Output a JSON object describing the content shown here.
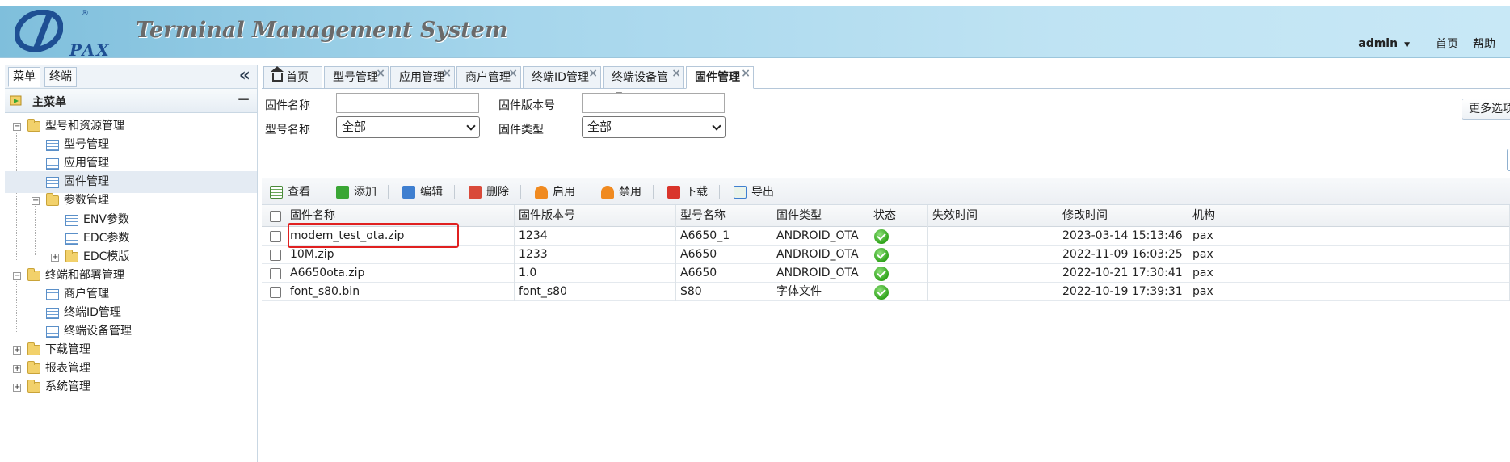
{
  "header": {
    "logo_text": "PAX",
    "logo_reg": "®",
    "title": "Terminal Management System",
    "user": "admin",
    "links": [
      "首页",
      "帮助"
    ]
  },
  "sidebar": {
    "tabs": [
      "菜单",
      "终端"
    ],
    "main_menu_title": "主菜单",
    "tree": [
      {
        "label": "型号和资源管理",
        "type": "folder",
        "level": 0,
        "expander": "−"
      },
      {
        "label": "型号管理",
        "type": "page",
        "level": 1
      },
      {
        "label": "应用管理",
        "type": "page",
        "level": 1
      },
      {
        "label": "固件管理",
        "type": "page",
        "level": 1,
        "selected": true
      },
      {
        "label": "参数管理",
        "type": "folder",
        "level": 1,
        "expander": "−"
      },
      {
        "label": "ENV参数",
        "type": "page",
        "level": 2
      },
      {
        "label": "EDC参数",
        "type": "page",
        "level": 2
      },
      {
        "label": "EDC模版",
        "type": "folder",
        "level": 2,
        "expander": "+"
      },
      {
        "label": "终端和部署管理",
        "type": "folder",
        "level": 0,
        "expander": "−"
      },
      {
        "label": "商户管理",
        "type": "page",
        "level": 1
      },
      {
        "label": "终端ID管理",
        "type": "page",
        "level": 1
      },
      {
        "label": "终端设备管理",
        "type": "page",
        "level": 1
      },
      {
        "label": "下载管理",
        "type": "folder",
        "level": 0,
        "expander": "+"
      },
      {
        "label": "报表管理",
        "type": "folder",
        "level": 0,
        "expander": "+"
      },
      {
        "label": "系统管理",
        "type": "folder",
        "level": 0,
        "expander": "+"
      }
    ]
  },
  "tabs": [
    {
      "label": "首页",
      "closable": false
    },
    {
      "label": "型号管理",
      "closable": true
    },
    {
      "label": "应用管理",
      "closable": true
    },
    {
      "label": "商户管理",
      "closable": true
    },
    {
      "label": "终端ID管理",
      "closable": true
    },
    {
      "label": "终端设备管理",
      "closable": true
    },
    {
      "label": "固件管理",
      "closable": true,
      "active": true
    }
  ],
  "search": {
    "firmware_name_label": "固件名称",
    "firmware_name_value": "",
    "firmware_version_label": "固件版本号",
    "firmware_version_value": "",
    "model_name_label": "型号名称",
    "model_name_value": "全部",
    "firmware_type_label": "固件类型",
    "firmware_type_value": "全部",
    "more_options": "更多选项"
  },
  "toolbar": {
    "view": "查看",
    "add": "添加",
    "edit": "编辑",
    "delete": "删除",
    "enable": "启用",
    "disable": "禁用",
    "download": "下载",
    "export": "导出"
  },
  "grid": {
    "columns": [
      "固件名称",
      "固件版本号",
      "型号名称",
      "固件类型",
      "状态",
      "失效时间",
      "修改时间",
      "机构"
    ],
    "rows": [
      {
        "name": "modem_test_ota.zip",
        "version": "1234",
        "model": "A6650_1",
        "type": "ANDROID_OTA",
        "status": "enabled",
        "expire": "",
        "modified": "2023-03-14 15:13:46",
        "org": "pax"
      },
      {
        "name": "10M.zip",
        "version": "1233",
        "model": "A6650",
        "type": "ANDROID_OTA",
        "status": "enabled",
        "expire": "",
        "modified": "2022-11-09 16:03:25",
        "org": "pax"
      },
      {
        "name": "A6650ota.zip",
        "version": "1.0",
        "model": "A6650",
        "type": "ANDROID_OTA",
        "status": "enabled",
        "expire": "",
        "modified": "2022-10-21 17:30:41",
        "org": "pax"
      },
      {
        "name": "font_s80.bin",
        "version": "font_s80",
        "model": "S80",
        "type": "字体文件",
        "status": "enabled",
        "expire": "",
        "modified": "2022-10-19 17:39:31",
        "org": "pax"
      }
    ]
  },
  "colors": {
    "header_gradient_start": "#7fbfdc",
    "header_gradient_end": "#c8e8f6",
    "status_ok": "#2fa31a",
    "highlight": "#e02020",
    "logo": "#1e4f93"
  }
}
